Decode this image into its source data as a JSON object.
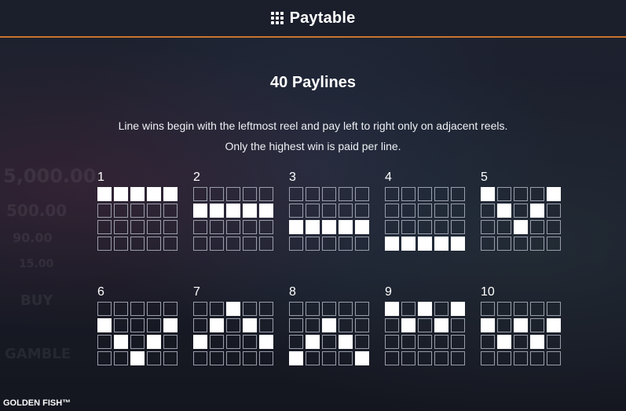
{
  "header": {
    "title": "Paytable",
    "menu_icon": "grid-dots-icon"
  },
  "section": {
    "title": "40 Paylines",
    "desc_line1": "Line wins begin with the leftmost reel and pay left to right only on adjacent reels.",
    "desc_line2": "Only the highest win is paid per line."
  },
  "paylines": [
    {
      "label": "1",
      "rows": [
        0,
        0,
        0,
        0,
        0
      ]
    },
    {
      "label": "2",
      "rows": [
        1,
        1,
        1,
        1,
        1
      ]
    },
    {
      "label": "3",
      "rows": [
        2,
        2,
        2,
        2,
        2
      ]
    },
    {
      "label": "4",
      "rows": [
        3,
        3,
        3,
        3,
        3
      ]
    },
    {
      "label": "5",
      "rows": [
        0,
        1,
        2,
        1,
        0
      ]
    },
    {
      "label": "6",
      "rows": [
        1,
        2,
        3,
        2,
        1
      ]
    },
    {
      "label": "7",
      "rows": [
        2,
        1,
        0,
        1,
        2
      ]
    },
    {
      "label": "8",
      "rows": [
        3,
        2,
        1,
        2,
        3
      ]
    },
    {
      "label": "9",
      "rows": [
        0,
        1,
        0,
        1,
        0
      ]
    },
    {
      "label": "10",
      "rows": [
        1,
        2,
        1,
        2,
        1
      ]
    }
  ],
  "background_text": {
    "jackpot1": "5,000.00",
    "jackpot2": "500.00",
    "jackpot3": "90.00",
    "jackpot4": "15.00",
    "buy": "BUY",
    "gamble": "GAMBLE"
  },
  "footer": {
    "game_name": "GOLDEN FISH™"
  },
  "colors": {
    "accent_line": "#c8752e",
    "header_bg": "#1b1e2b",
    "cell_on": "#ffffff",
    "cell_border": "#9a9eab"
  }
}
